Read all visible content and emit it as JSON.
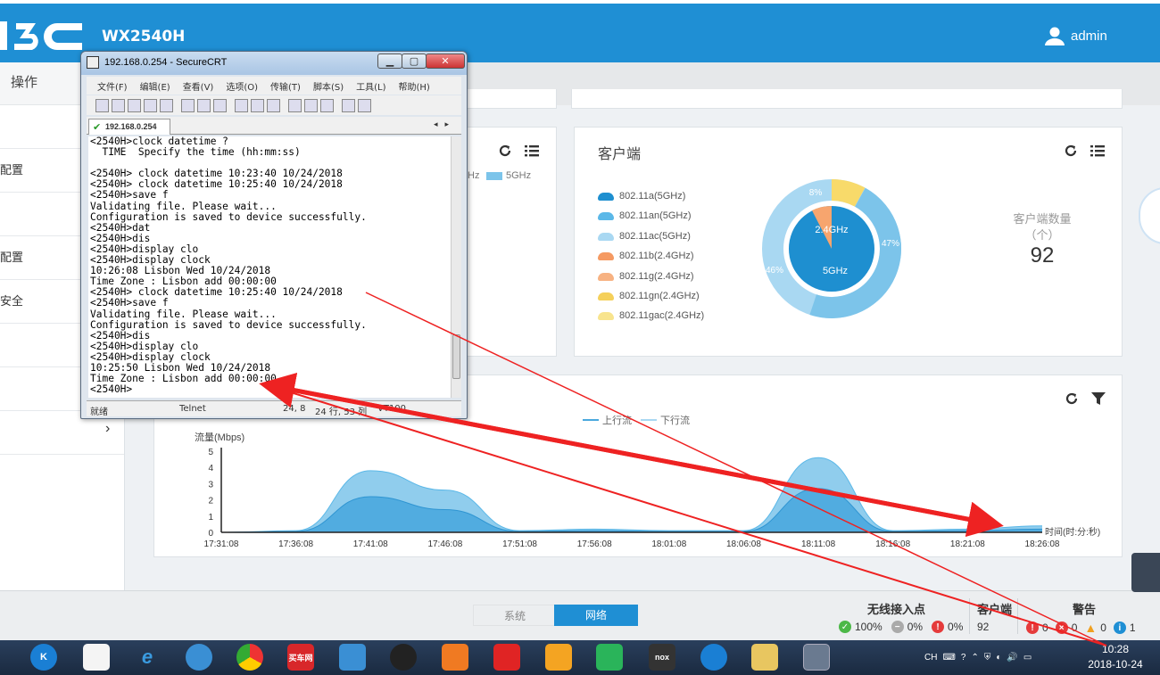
{
  "header": {
    "product": "WX2540H",
    "user": "admin"
  },
  "nav": {
    "head": "操作",
    "items": [
      "",
      "配置",
      "",
      "配置",
      "安全",
      "",
      "",
      ""
    ]
  },
  "panel_left": {
    "legend_partial": "Hz",
    "legend_5g": "5GHz"
  },
  "panel_clients": {
    "title": "客户端",
    "legend": [
      "802.11a(5GHz)",
      "802.11an(5GHz)",
      "802.11ac(5GHz)",
      "802.11b(2.4GHz)",
      "802.11g(2.4GHz)",
      "802.11gn(2.4GHz)",
      "802.11gac(2.4GHz)"
    ],
    "legend_colors": [
      "#1e8fd0",
      "#5bb8e8",
      "#a9d8f2",
      "#f59a62",
      "#f7b282",
      "#f5d05a",
      "#f8e48e"
    ],
    "count_label": "客户端数量",
    "count_unit": "（个）",
    "count": "92",
    "donut": {
      "inner_2g": "2.4GHz",
      "inner_5g": "5GHz",
      "outer_8": "8%",
      "outer_47": "47%",
      "outer_46": "46%"
    }
  },
  "chart_data": {
    "type": "area",
    "title": "",
    "ylabel": "流量(Mbps)",
    "xlabel": "时间(时:分:秒)",
    "legend": [
      "上行流",
      "下行流"
    ],
    "y_ticks": [
      0,
      1,
      2,
      3,
      4,
      5
    ],
    "ylim": [
      0,
      5
    ],
    "categories": [
      "17:31:08",
      "17:36:08",
      "17:41:08",
      "17:46:08",
      "17:51:08",
      "17:56:08",
      "18:01:08",
      "18:06:08",
      "18:11:08",
      "18:16:08",
      "18:21:08",
      "18:26:08"
    ],
    "series": [
      {
        "name": "上行流",
        "color": "#7cc4ea",
        "values": [
          0,
          0.1,
          3.8,
          2.6,
          0.1,
          0.2,
          0.1,
          0.1,
          4.6,
          0.1,
          0.2,
          0.4
        ]
      },
      {
        "name": "下行流",
        "color": "#4aa8de",
        "values": [
          0,
          0.05,
          2.2,
          1.4,
          0.05,
          0.1,
          0.05,
          0.05,
          2.7,
          0.05,
          0.1,
          0.2
        ]
      }
    ]
  },
  "bottom": {
    "tabs": {
      "system": "系统",
      "network": "网络"
    },
    "ap": {
      "title": "无线接入点",
      "green": "100%",
      "gray": "0%",
      "red": "0%"
    },
    "client": {
      "title": "客户端",
      "count": "92"
    },
    "alarm": {
      "title": "警告",
      "c1": "0",
      "c2": "0",
      "c3": "0",
      "c4": "1"
    }
  },
  "crt": {
    "title": "192.168.0.254 - SecureCRT",
    "menu": [
      "文件(F)",
      "编辑(E)",
      "查看(V)",
      "选项(O)",
      "传输(T)",
      "脚本(S)",
      "工具(L)",
      "帮助(H)"
    ],
    "tab": "192.168.0.254",
    "lines": [
      "<2540H>clock datetime ?",
      "  TIME  Specify the time (hh:mm:ss)",
      "",
      "<2540H> clock datetime 10:23:40 10/24/2018",
      "<2540H> clock datetime 10:25:40 10/24/2018",
      "<2540H>save f",
      "Validating file. Please wait...",
      "Configuration is saved to device successfully.",
      "<2540H>dat",
      "<2540H>dis",
      "<2540H>display clo",
      "<2540H>display clock",
      "10:26:08 Lisbon Wed 10/24/2018",
      "Time Zone : Lisbon add 00:00:00",
      "<2540H> clock datetime 10:25:40 10/24/2018",
      "<2540H>save f",
      "Validating file. Please wait...",
      "Configuration is saved to device successfully.",
      "<2540H>dis",
      "<2540H>display clo",
      "<2540H>display clock",
      "10:25:50 Lisbon Wed 10/24/2018",
      "Time Zone : Lisbon add 00:00:00",
      "<2540H>"
    ],
    "status": {
      "ready": "就绪",
      "proto": "Telnet",
      "pos": "24,  8",
      "size": "24 行, 53 列",
      "term": "VT100"
    }
  },
  "taskbar": {
    "apps": [
      "K",
      "",
      "e",
      "",
      "",
      "买车网",
      "",
      "",
      "",
      "",
      "",
      "",
      "nox",
      "",
      "",
      ""
    ],
    "tray_lang": "CH",
    "time": "10:28",
    "date": "2018-10-24"
  }
}
